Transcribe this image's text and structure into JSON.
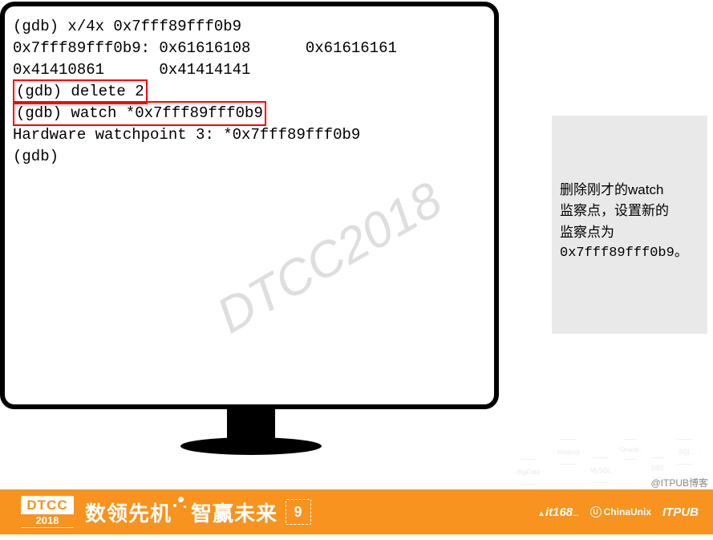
{
  "terminal": {
    "line1": "(gdb) x/4x 0x7fff89fff0b9",
    "line2": "0x7fff89fff0b9: 0x61616108      0x61616161",
    "line3": "0x41410861      0x41414141",
    "line4": "(gdb) delete 2",
    "line5": "(gdb) watch *0x7fff89fff0b9",
    "line6": "Hardware watchpoint 3: *0x7fff89fff0b9",
    "line7": "(gdb)"
  },
  "watermark": "DTCC2018",
  "side_note": {
    "line1": "删除刚才的watch",
    "line2": "监察点，设置新的",
    "line3": "监察点为",
    "line4": "0x7fff89fff0b9。"
  },
  "hex_labels": {
    "h1": "BigData",
    "h2": "Hadoop",
    "h3": "MySQL",
    "h4": "SQL",
    "h5": "DB2",
    "h6": "Oracle"
  },
  "footer": {
    "badge_top": "DTCC",
    "badge_year": "2018",
    "slogan_a": "数领先机",
    "slogan_b": "智赢未来",
    "slogan_num": "9",
    "sp_it168": "it168",
    "sp_it168_suffix": "...",
    "sp_china_u": "U",
    "sp_china": "ChinaUnix",
    "sp_itpub": "ITPUB"
  },
  "credit": "@ITPUB博客"
}
